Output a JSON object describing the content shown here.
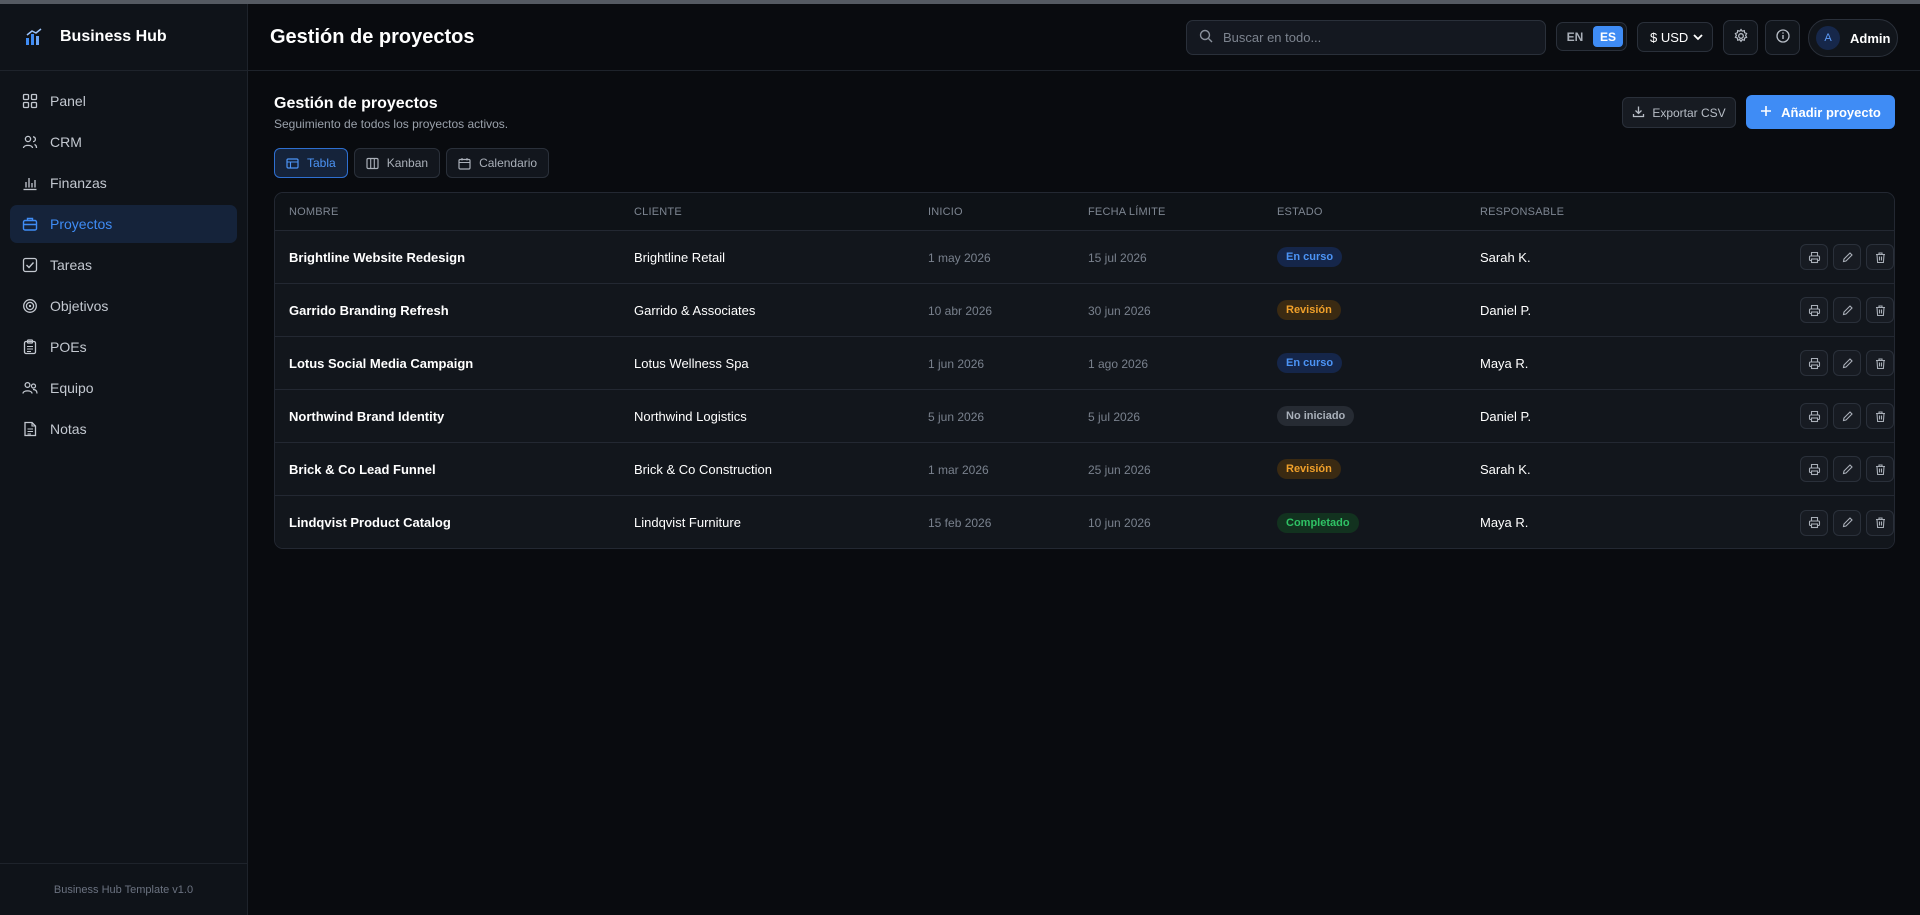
{
  "app": {
    "name": "Business Hub",
    "footer": "Business Hub Template v1.0"
  },
  "sidebar": {
    "items": [
      {
        "label": "Panel",
        "icon": "grid-icon",
        "active": false
      },
      {
        "label": "CRM",
        "icon": "users-icon",
        "active": false
      },
      {
        "label": "Finanzas",
        "icon": "bar-chart-icon",
        "active": false
      },
      {
        "label": "Proyectos",
        "icon": "briefcase-icon",
        "active": true
      },
      {
        "label": "Tareas",
        "icon": "checkbox-icon",
        "active": false
      },
      {
        "label": "Objetivos",
        "icon": "target-icon",
        "active": false
      },
      {
        "label": "POEs",
        "icon": "clipboard-icon",
        "active": false
      },
      {
        "label": "Equipo",
        "icon": "team-icon",
        "active": false
      },
      {
        "label": "Notas",
        "icon": "file-text-icon",
        "active": false
      }
    ]
  },
  "header": {
    "title": "Gestión de proyectos",
    "search_placeholder": "Buscar en todo...",
    "lang": {
      "options": [
        "EN",
        "ES"
      ],
      "selected": "ES"
    },
    "currency": "$ USD",
    "user": {
      "initial": "A",
      "name": "Admin"
    }
  },
  "main": {
    "title": "Gestión de proyectos",
    "subtitle": "Seguimiento de todos los proyectos activos.",
    "export_label": "Exportar CSV",
    "add_label": "Añadir proyecto",
    "views": [
      {
        "label": "Tabla",
        "icon": "table-icon",
        "active": true
      },
      {
        "label": "Kanban",
        "icon": "columns-icon",
        "active": false
      },
      {
        "label": "Calendario",
        "icon": "calendar-icon",
        "active": false
      }
    ],
    "table": {
      "columns": [
        "NOMBRE",
        "CLIENTE",
        "INICIO",
        "FECHA LÍMITE",
        "ESTADO",
        "RESPONSABLE"
      ],
      "rows": [
        {
          "name": "Brightline Website Redesign",
          "client": "Brightline Retail",
          "start": "1 may 2026",
          "due": "15 jul 2026",
          "status": "En curso",
          "status_kind": "progress",
          "owner": "Sarah K."
        },
        {
          "name": "Garrido Branding Refresh",
          "client": "Garrido & Associates",
          "start": "10 abr 2026",
          "due": "30 jun 2026",
          "status": "Revisión",
          "status_kind": "review",
          "owner": "Daniel P."
        },
        {
          "name": "Lotus Social Media Campaign",
          "client": "Lotus Wellness Spa",
          "start": "1 jun 2026",
          "due": "1 ago 2026",
          "status": "En curso",
          "status_kind": "progress",
          "owner": "Maya R."
        },
        {
          "name": "Northwind Brand Identity",
          "client": "Northwind Logistics",
          "start": "5 jun 2026",
          "due": "5 jul 2026",
          "status": "No iniciado",
          "status_kind": "notstarted",
          "owner": "Daniel P."
        },
        {
          "name": "Brick & Co Lead Funnel",
          "client": "Brick & Co Construction",
          "start": "1 mar 2026",
          "due": "25 jun 2026",
          "status": "Revisión",
          "status_kind": "review",
          "owner": "Sarah K."
        },
        {
          "name": "Lindqvist Product Catalog",
          "client": "Lindqvist Furniture",
          "start": "15 feb 2026",
          "due": "10 jun 2026",
          "status": "Completado",
          "status_kind": "done",
          "owner": "Maya R."
        }
      ]
    }
  },
  "colors": {
    "accent": "#3f8cf5",
    "status": {
      "progress": {
        "bg": "#15264a",
        "fg": "#4c94f6"
      },
      "review": {
        "bg": "#3a2a12",
        "fg": "#f0a02a"
      },
      "notstarted": {
        "bg": "#262b33",
        "fg": "#a9b0ba"
      },
      "done": {
        "bg": "#12321f",
        "fg": "#2fc265"
      }
    }
  }
}
